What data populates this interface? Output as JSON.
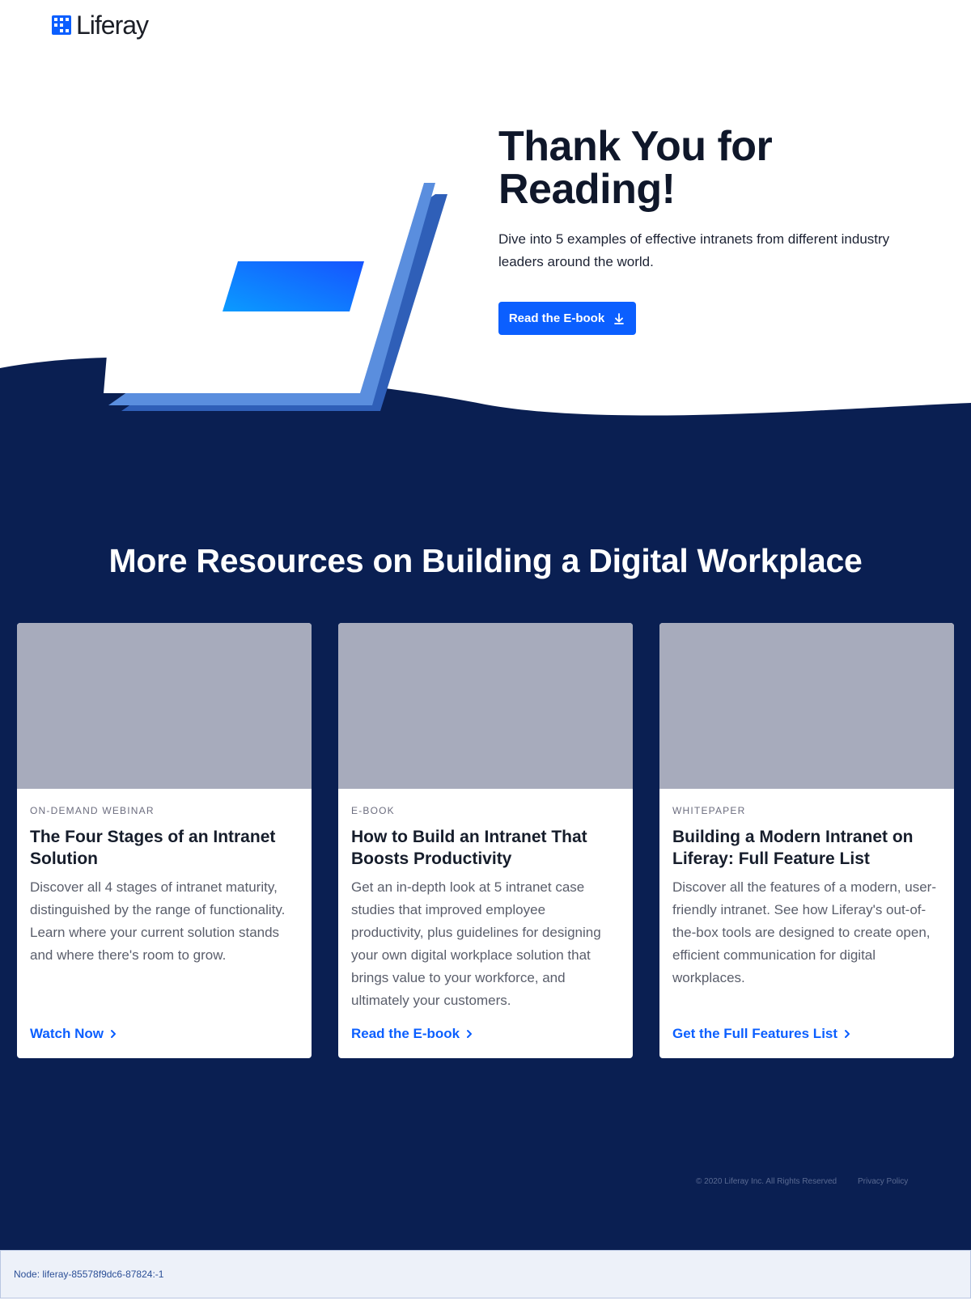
{
  "header": {
    "logo_text": "Liferay"
  },
  "hero": {
    "title": "Thank You for Reading!",
    "subtitle": "Dive into 5 examples of effective intranets from different industry leaders around the world.",
    "button_label": "Read the E-book",
    "button_icon": "download-icon"
  },
  "resources": {
    "title": "More Resources on Building a Digital Workplace",
    "cards": [
      {
        "tag": "ON-DEMAND WEBINAR",
        "title": "The Four Stages of an Intranet Solution",
        "description": "Discover all 4 stages of intranet maturity, distinguished by the range of functionality. Learn where your current solution stands and where there's room to grow.",
        "link": "Watch Now"
      },
      {
        "tag": "E-BOOK",
        "title": "How to Build an Intranet That Boosts Productivity",
        "description": "Get an in-depth look at 5 intranet case studies that improved employee productivity, plus guidelines for designing your own digital workplace solution that brings value to your workforce, and ultimately your customers.",
        "link": "Read the E-book"
      },
      {
        "tag": "WHITEPAPER",
        "title": "Building a Modern Intranet on Liferay: Full Feature List",
        "description": "Discover all the features of a modern, user-friendly intranet. See how Liferay's out-of-the-box tools are designed to create open, efficient communication for digital workplaces.",
        "link": "Get the Full Features List"
      }
    ]
  },
  "footer": {
    "copyright": "© 2020 Liferay Inc. All Rights Reserved",
    "privacy": "Privacy Policy"
  },
  "node_bar": {
    "text": "Node: liferay-85578f9dc6-87824:-1"
  },
  "colors": {
    "brand_blue": "#0b5fff",
    "navy": "#0a1f52",
    "card_image_placeholder": "#a7abbc"
  }
}
